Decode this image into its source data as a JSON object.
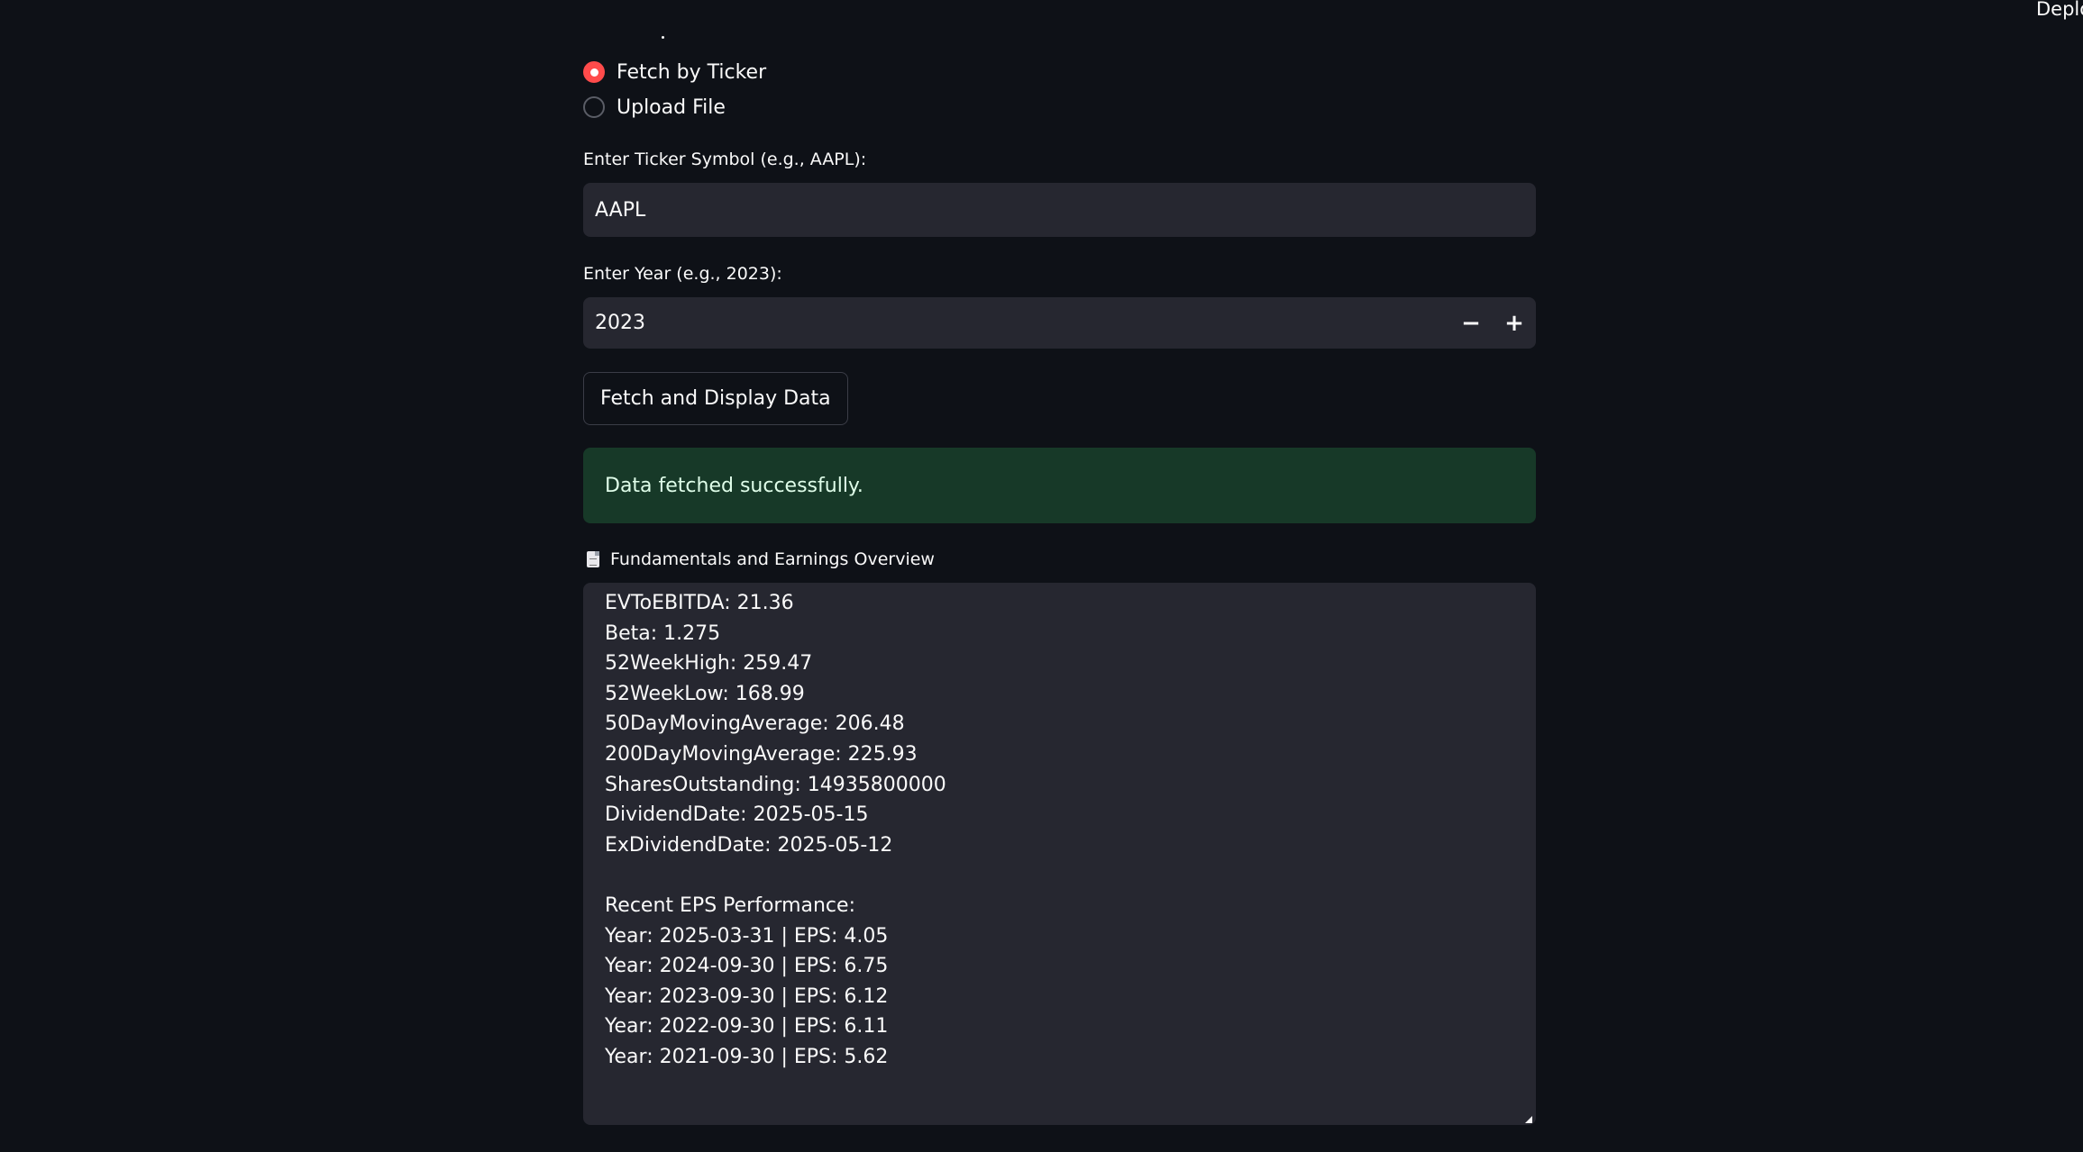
{
  "header": {
    "deploy_label": "Deploy"
  },
  "source_radio": {
    "options": [
      {
        "label": "Fetch by Ticker",
        "selected": true
      },
      {
        "label": "Upload File",
        "selected": false
      }
    ]
  },
  "ticker": {
    "label": "Enter Ticker Symbol (e.g., AAPL):",
    "value": "AAPL"
  },
  "year": {
    "label": "Enter Year (e.g., 2023):",
    "value": "2023",
    "decrement_icon": "minus-icon",
    "increment_icon": "plus-icon"
  },
  "fetch_button": {
    "label": "Fetch and Display Data"
  },
  "alert": {
    "message": "Data fetched successfully.",
    "color": "#173928"
  },
  "overview": {
    "icon": "document-icon",
    "label": "Fundamentals and Earnings Overview",
    "lines": [
      "EVToEBITDA: 21.36",
      "Beta: 1.275",
      "52WeekHigh: 259.47",
      "52WeekLow: 168.99",
      "50DayMovingAverage: 206.48",
      "200DayMovingAverage: 225.93",
      "SharesOutstanding: 14935800000",
      "DividendDate: 2025-05-15",
      "ExDividendDate: 2025-05-12",
      "",
      "Recent EPS Performance:",
      "Year: 2025-03-31 | EPS: 4.05",
      "Year: 2024-09-30 | EPS: 6.75",
      "Year: 2023-09-30 | EPS: 6.12",
      "Year: 2022-09-30 | EPS: 6.11",
      "Year: 2021-09-30 | EPS: 5.62"
    ]
  },
  "colors": {
    "background": "#0e1117",
    "input_bg": "#262730",
    "accent": "#ff4b4b"
  }
}
